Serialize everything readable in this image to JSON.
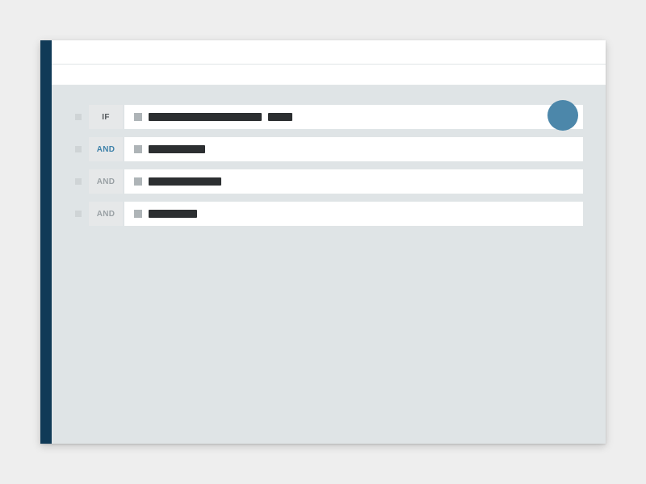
{
  "header": {
    "row1": "",
    "row2": ""
  },
  "rules": [
    {
      "op": "IF",
      "op_style": "if"
    },
    {
      "op": "AND",
      "op_style": "active"
    },
    {
      "op": "AND",
      "op_style": ""
    },
    {
      "op": "AND",
      "op_style": ""
    }
  ],
  "condition_shapes": [
    [
      140,
      30
    ],
    [
      70
    ],
    [
      90
    ],
    [
      60
    ]
  ],
  "colors": {
    "sidebar": "#103a57",
    "accent": "#4c87aa",
    "panel": "#dfe4e6"
  }
}
